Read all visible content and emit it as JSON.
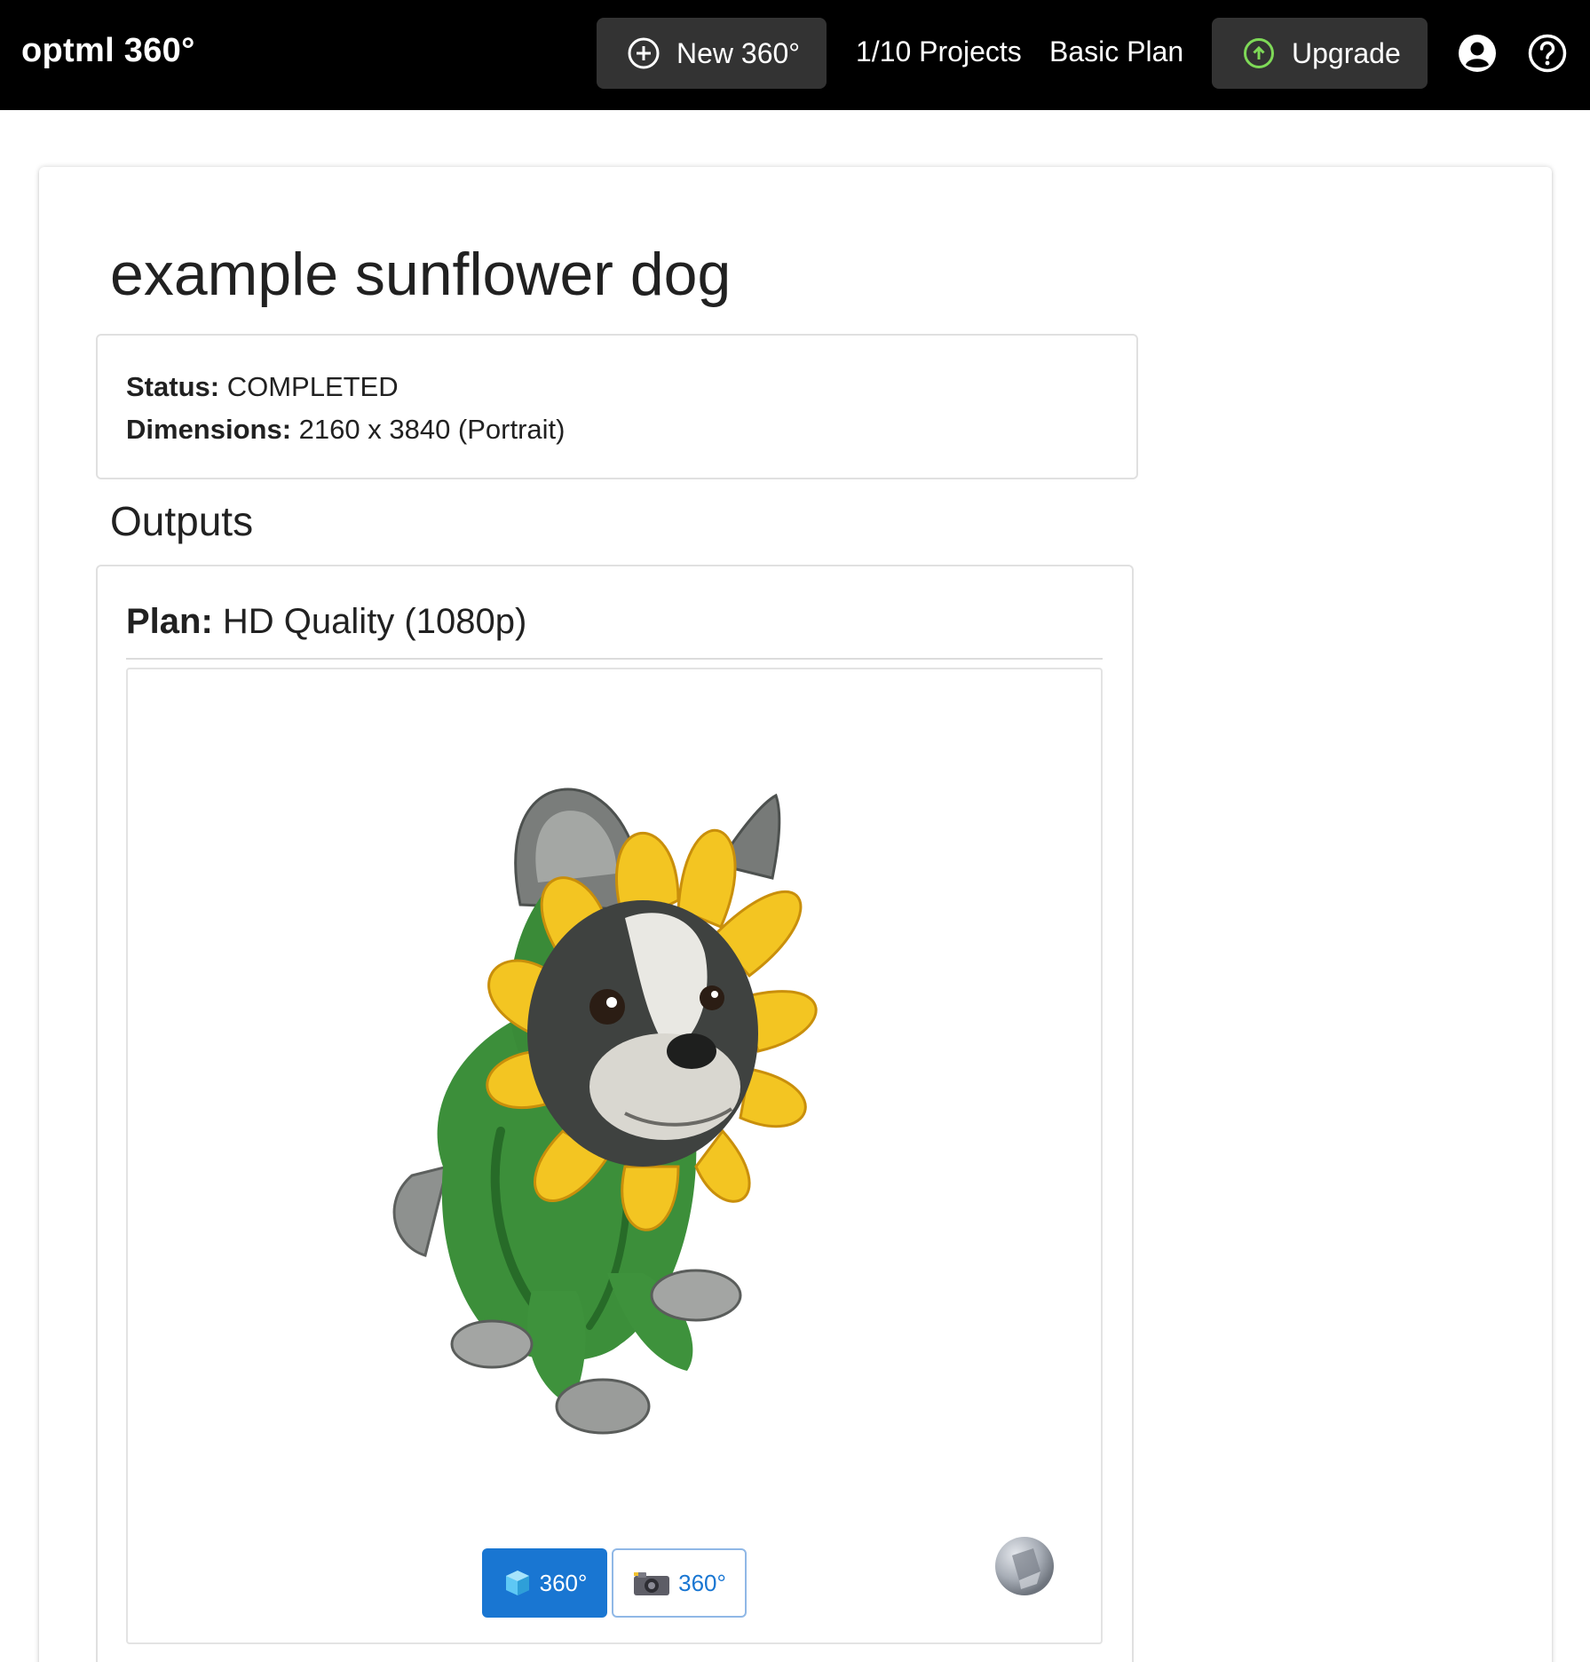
{
  "header": {
    "brand": "optml 360°",
    "new_button": "New 360°",
    "projects": "1/10 Projects",
    "plan": "Basic Plan",
    "upgrade_button": "Upgrade"
  },
  "project": {
    "title": "example sunflower dog",
    "status_label": "Status:",
    "status_value": "COMPLETED",
    "dimensions_label": "Dimensions:",
    "dimensions_value": "2160 x 3840 (Portrait)"
  },
  "outputs": {
    "heading": "Outputs",
    "plan_label": "Plan:",
    "plan_value": "HD Quality (1080p)",
    "mode_3d_label": "360°",
    "mode_photo_label": "360°"
  },
  "icons": {
    "new": "plus-circle-icon",
    "upgrade": "arrow-up-circle-icon",
    "account": "account-circle-icon",
    "help": "help-circle-icon",
    "mode_3d": "cube-icon",
    "mode_photo": "camera-icon",
    "viewer_orb": "sphere-icon"
  },
  "colors": {
    "topbar": "#000000",
    "nav_button": "#333333",
    "upgrade_icon": "#7ed957",
    "primary": "#1976d2",
    "border": "#e0e0e0"
  }
}
